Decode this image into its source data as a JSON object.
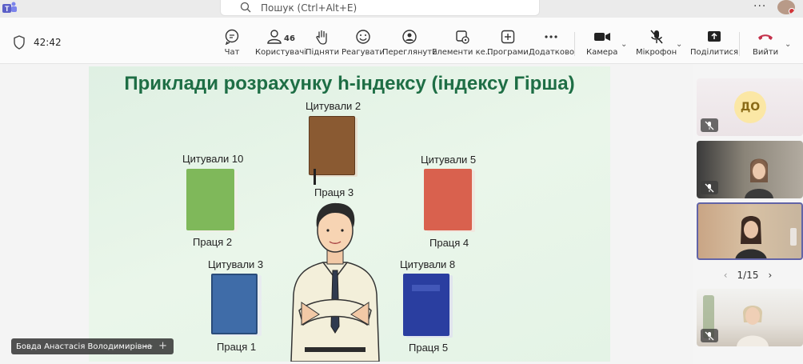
{
  "topbar": {
    "search_placeholder": "Пошук (Ctrl+Alt+E)",
    "more": "···"
  },
  "meeting": {
    "timer": "42:42"
  },
  "toolbar": {
    "chat": "Чат",
    "people": "Користувачі",
    "people_count": "46",
    "raise": "Підняти",
    "react": "Реагувати",
    "view": "Переглянути",
    "apps_elements": "Елементи ке...",
    "apps": "Програми",
    "more": "Додатково",
    "camera": "Камера",
    "mic": "Мікрофон",
    "share": "Поділитися",
    "leave": "Вийти"
  },
  "slide": {
    "title": "Приклади розрахунку h-індексу (індексу Гірша)",
    "books": [
      {
        "cited": "Цитували 2",
        "label": "Праця 3",
        "color": "#8a5a32"
      },
      {
        "cited": "Цитували 10",
        "label": "Праця 2",
        "color": "#7fb85a"
      },
      {
        "cited": "Цитували 5",
        "label": "Праця 4",
        "color": "#d9614e"
      },
      {
        "cited": "Цитували 3",
        "label": "Праця 1",
        "color": "#3f6ca8"
      },
      {
        "cited": "Цитували 8",
        "label": "Праця 5",
        "color": "#2a3ea0"
      }
    ]
  },
  "presenter": {
    "name": "Бовда Анастасія Володимирівна"
  },
  "participants": {
    "tile1_initials": "ДО",
    "pager": "1/15"
  }
}
